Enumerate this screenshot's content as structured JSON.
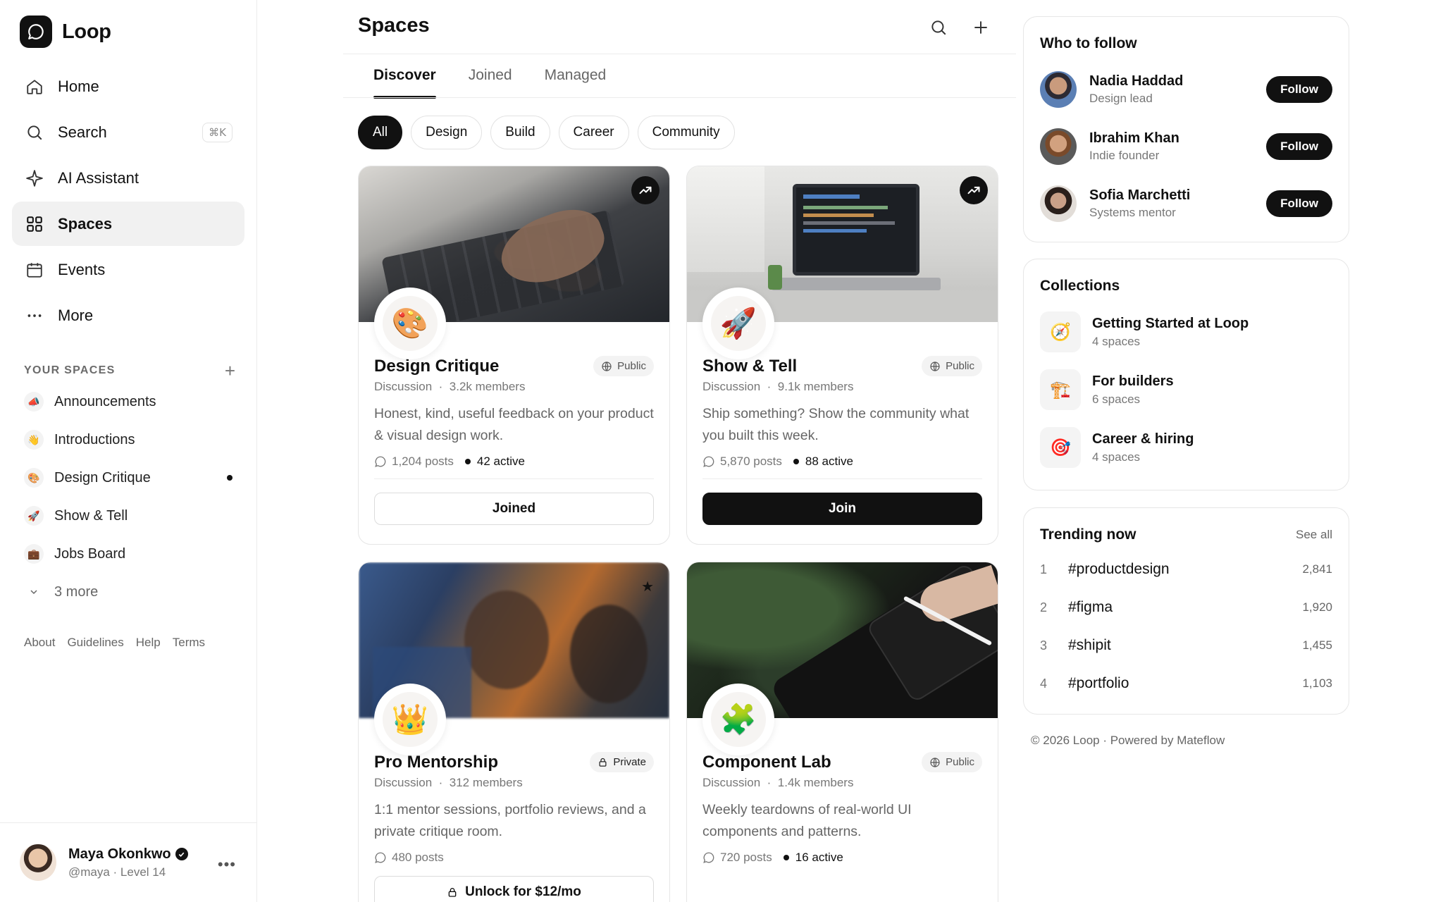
{
  "app": {
    "name": "Loop"
  },
  "nav": {
    "items": [
      {
        "label": "Home",
        "icon": "home-icon"
      },
      {
        "label": "Search",
        "icon": "search-icon",
        "shortcut": "⌘K"
      },
      {
        "label": "AI Assistant",
        "icon": "sparkle-icon"
      },
      {
        "label": "Spaces",
        "icon": "grid-icon",
        "active": true
      },
      {
        "label": "Events",
        "icon": "calendar-icon"
      },
      {
        "label": "More",
        "icon": "more-icon"
      }
    ]
  },
  "your_spaces": {
    "title": "YOUR SPACES",
    "items": [
      {
        "label": "Announcements",
        "emoji": "📣",
        "unread": false
      },
      {
        "label": "Introductions",
        "emoji": "👋",
        "unread": false
      },
      {
        "label": "Design Critique",
        "emoji": "🎨",
        "unread": true
      },
      {
        "label": "Show & Tell",
        "emoji": "🚀",
        "unread": false
      },
      {
        "label": "Jobs Board",
        "emoji": "💼",
        "unread": false
      }
    ],
    "more_label": "3 more"
  },
  "footer_links": [
    "About",
    "Guidelines",
    "Help",
    "Terms"
  ],
  "user": {
    "name": "Maya Okonkwo",
    "sub": "@maya · Level 14"
  },
  "main": {
    "title": "Spaces",
    "tabs": [
      "Discover",
      "Joined",
      "Managed"
    ],
    "active_tab": "Discover",
    "filters": [
      "All",
      "Design",
      "Build",
      "Career",
      "Community"
    ],
    "active_filter": "All"
  },
  "cards": [
    {
      "title": "Design Critique",
      "emoji": "🎨",
      "visibility": "Public",
      "type": "Discussion",
      "members": "3.2k members",
      "description": "Honest, kind, useful feedback on your product & visual design work.",
      "posts": "1,204 posts",
      "active": "42 active",
      "button": "Joined",
      "button_style": "outline",
      "badge": "trending"
    },
    {
      "title": "Show & Tell",
      "emoji": "🚀",
      "visibility": "Public",
      "type": "Discussion",
      "members": "9.1k members",
      "description": "Ship something? Show the community what you built this week.",
      "posts": "5,870 posts",
      "active": "88 active",
      "button": "Join",
      "button_style": "dark",
      "badge": "trending"
    },
    {
      "title": "Pro Mentorship",
      "emoji": "👑",
      "visibility": "Private",
      "type": "Discussion",
      "members": "312 members",
      "description": "1:1 mentor sessions, portfolio reviews, and a private critique room.",
      "posts": "480 posts",
      "active": "",
      "button": "Unlock for $12/mo",
      "button_style": "outline",
      "badge": "star"
    },
    {
      "title": "Component Lab",
      "emoji": "🧩",
      "visibility": "Public",
      "type": "Discussion",
      "members": "1.4k members",
      "description": "Weekly teardowns of real-world UI components and patterns.",
      "posts": "720 posts",
      "active": "16 active",
      "button": "",
      "button_style": "outline",
      "badge": ""
    }
  ],
  "who_to_follow": {
    "title": "Who to follow",
    "people": [
      {
        "name": "Nadia Haddad",
        "role": "Design lead",
        "button": "Follow"
      },
      {
        "name": "Ibrahim Khan",
        "role": "Indie founder",
        "button": "Follow"
      },
      {
        "name": "Sofia Marchetti",
        "role": "Systems mentor",
        "button": "Follow"
      }
    ]
  },
  "collections": {
    "title": "Collections",
    "items": [
      {
        "name": "Getting Started at Loop",
        "count": "4 spaces",
        "emoji": "🧭"
      },
      {
        "name": "For builders",
        "count": "6 spaces",
        "emoji": "🏗️"
      },
      {
        "name": "Career & hiring",
        "count": "4 spaces",
        "emoji": "🎯"
      }
    ]
  },
  "trending": {
    "title": "Trending now",
    "see_all": "See all",
    "items": [
      {
        "rank": "1",
        "tag": "#productdesign",
        "count": "2,841"
      },
      {
        "rank": "2",
        "tag": "#figma",
        "count": "1,920"
      },
      {
        "rank": "3",
        "tag": "#shipit",
        "count": "1,455"
      },
      {
        "rank": "4",
        "tag": "#portfolio",
        "count": "1,103"
      }
    ]
  },
  "copyright": "© 2026 Loop · Powered by Mateflow"
}
